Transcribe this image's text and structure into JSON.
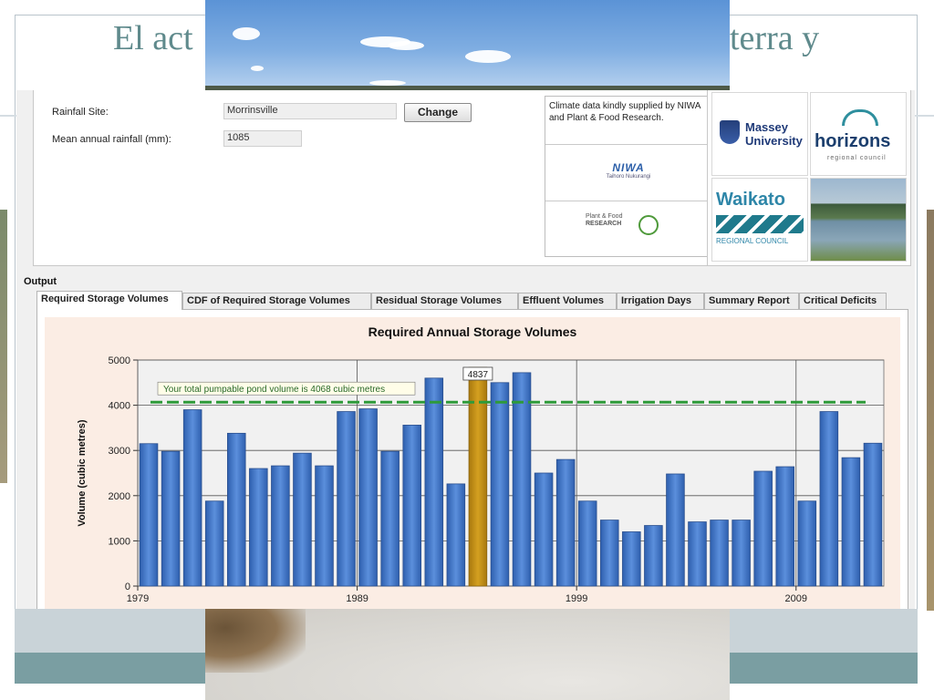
{
  "slide": {
    "title_left": "El act",
    "title_right": "terra y"
  },
  "inputs": {
    "rainfall_site_label": "Rainfall Site:",
    "rainfall_site_value": "Morrinsville",
    "change_button": "Change",
    "mean_rainfall_label": "Mean annual rainfall (mm):",
    "mean_rainfall_value": "1085"
  },
  "credits": {
    "text": "Climate data kindly supplied by NIWA and Plant & Food Research.",
    "niwa_logo": "NIWA",
    "niwa_sub": "Taihoro Nukurangi",
    "pfr_logo_line1": "Plant & Food",
    "pfr_logo_line2": "RESEARCH"
  },
  "logos": {
    "massey_line1": "Massey",
    "massey_line2": "University",
    "horizons": "horizons",
    "horizons_sub": "regional council",
    "waikato": "Waikato",
    "waikato_sub": "REGIONAL COUNCIL"
  },
  "output": {
    "label": "Output",
    "tabs": [
      "Required Storage Volumes",
      "CDF of Required Storage Volumes",
      "Residual Storage Volumes",
      "Effluent Volumes",
      "Irrigation Days",
      "Summary Report",
      "Critical Deficits"
    ],
    "active_tab": 0
  },
  "colors": {
    "bar": "#5b8fdc",
    "bar_dark": "#2e5fae",
    "bar_highlight": "#d4a020",
    "threshold_line": "#2e9a3a",
    "plot_bg": "#f1f1f1",
    "chart_bg": "#fbede4",
    "slide_title": "#5f8a8c"
  },
  "chart_data": {
    "type": "bar",
    "title": "Required Annual Storage Volumes",
    "ylabel": "Volume (cubic metres)",
    "xlabel": "",
    "ylim": [
      0,
      5000
    ],
    "yticks": [
      0,
      1000,
      2000,
      3000,
      4000,
      5000
    ],
    "xlim": [
      1979,
      2013
    ],
    "xticks": [
      1979,
      1989,
      1999,
      2009
    ],
    "x": [
      1979,
      1980,
      1981,
      1982,
      1983,
      1984,
      1985,
      1986,
      1987,
      1988,
      1989,
      1990,
      1991,
      1992,
      1993,
      1994,
      1995,
      1996,
      1997,
      1998,
      1999,
      2000,
      2001,
      2002,
      2003,
      2004,
      2005,
      2006,
      2007,
      2008,
      2009,
      2010,
      2011,
      2012
    ],
    "values": [
      3150,
      2980,
      3900,
      1880,
      3380,
      2600,
      2660,
      2940,
      2660,
      3860,
      3920,
      2980,
      3560,
      4600,
      2260,
      4837,
      4500,
      4720,
      2500,
      2800,
      1880,
      1460,
      1200,
      1340,
      2480,
      1420,
      1460,
      1460,
      2540,
      2640,
      1880,
      3860,
      2840,
      3160
    ],
    "highlight_index": 15,
    "highlight_label": "4837",
    "threshold": 4068,
    "annotation": "Your total pumpable pond volume is 4068 cubic metres",
    "grid": true
  }
}
